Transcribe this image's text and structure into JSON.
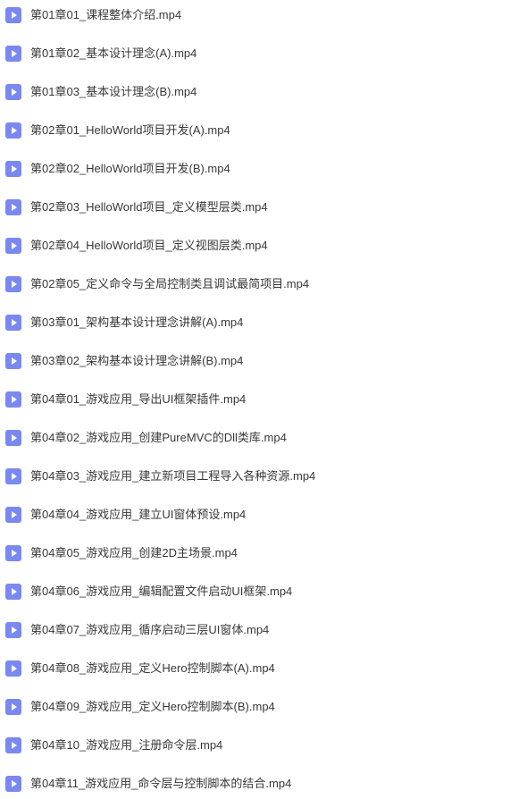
{
  "files": [
    {
      "name": "第01章01_课程整体介绍.mp4"
    },
    {
      "name": "第01章02_基本设计理念(A).mp4"
    },
    {
      "name": "第01章03_基本设计理念(B).mp4"
    },
    {
      "name": "第02章01_HelloWorld项目开发(A).mp4"
    },
    {
      "name": "第02章02_HelloWorld项目开发(B).mp4"
    },
    {
      "name": "第02章03_HelloWorld项目_定义模型层类.mp4"
    },
    {
      "name": "第02章04_HelloWorld项目_定义视图层类.mp4"
    },
    {
      "name": "第02章05_定义命令与全局控制类且调试最简项目.mp4"
    },
    {
      "name": "第03章01_架构基本设计理念讲解(A).mp4"
    },
    {
      "name": "第03章02_架构基本设计理念讲解(B).mp4"
    },
    {
      "name": "第04章01_游戏应用_导出UI框架插件.mp4"
    },
    {
      "name": "第04章02_游戏应用_创建PureMVC的Dll类库.mp4"
    },
    {
      "name": "第04章03_游戏应用_建立新项目工程导入各种资源.mp4"
    },
    {
      "name": "第04章04_游戏应用_建立UI窗体预设.mp4"
    },
    {
      "name": "第04章05_游戏应用_创建2D主场景.mp4"
    },
    {
      "name": "第04章06_游戏应用_编辑配置文件启动UI框架.mp4"
    },
    {
      "name": "第04章07_游戏应用_循序启动三层UI窗体.mp4"
    },
    {
      "name": "第04章08_游戏应用_定义Hero控制脚本(A).mp4"
    },
    {
      "name": "第04章09_游戏应用_定义Hero控制脚本(B).mp4"
    },
    {
      "name": "第04章10_游戏应用_注册命令层.mp4"
    },
    {
      "name": "第04章11_游戏应用_命令层与控制脚本的结合.mp4"
    }
  ]
}
